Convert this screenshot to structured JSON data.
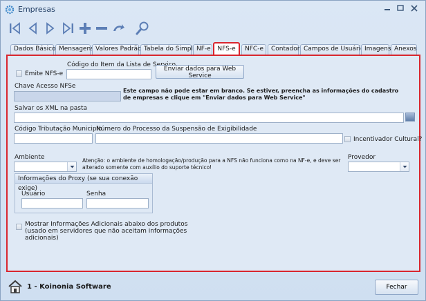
{
  "window": {
    "title": "Empresas",
    "accent_color": "#d9262e"
  },
  "toolbar": {
    "buttons": [
      "first-record",
      "previous-record",
      "next-record",
      "last-record",
      "add",
      "remove",
      "undo",
      "search"
    ]
  },
  "tabs": [
    {
      "label": "Dados Básicos",
      "active": false
    },
    {
      "label": "Mensagens",
      "active": false
    },
    {
      "label": "Valores Padrão",
      "active": false
    },
    {
      "label": "Tabela do Simples",
      "active": false
    },
    {
      "label": "NF-e",
      "active": false
    },
    {
      "label": "NFS-e",
      "active": true
    },
    {
      "label": "NFC-e",
      "active": false
    },
    {
      "label": "Contador",
      "active": false
    },
    {
      "label": "Campos de Usuários",
      "active": false
    },
    {
      "label": "Imagens",
      "active": false
    },
    {
      "label": "Anexos",
      "active": false
    }
  ],
  "nfse": {
    "emite_label": "Emite NFS-e",
    "codigo_item_label": "Código do Item da Lista de Serviço",
    "codigo_item_value": "",
    "enviar_button": "Enviar dados para Web Service",
    "chave_label": "Chave Acesso NFSe",
    "chave_value": "",
    "chave_warning": "Este campo não pode estar em branco. Se estiver, preencha as informações do cadastro de empresas e clique em \"Enviar dados para Web Service\"",
    "xml_label": "Salvar os XML na pasta",
    "xml_value": "",
    "codigo_tributacao_label": "Código Tributação Municipio",
    "codigo_tributacao_value": "",
    "numero_processo_label": "Número do Processo da Suspensão de Exigibilidade",
    "numero_processo_value": "",
    "incentivador_label": "Incentivador Cultural?",
    "ambiente_label": "Ambiente",
    "ambiente_value": "",
    "ambiente_note": "Atenção: o ambiente de homologação/produção para a NFS não funciona como na NF-e, e deve ser alterado somente com auxílio do suporte técnico!",
    "provedor_label": "Provedor",
    "provedor_value": "",
    "proxy_title": "Informações do Proxy (se sua conexão exige)",
    "usuario_label": "Usuário",
    "usuario_value": "",
    "senha_label": "Senha",
    "senha_value": "",
    "mostrar_info_label": "Mostrar Informações Adicionais abaixo dos produtos (usado em servidores que não aceitam informações adicionais)"
  },
  "status": {
    "company": "1 - Koinonia Software",
    "close_button": "Fechar"
  }
}
